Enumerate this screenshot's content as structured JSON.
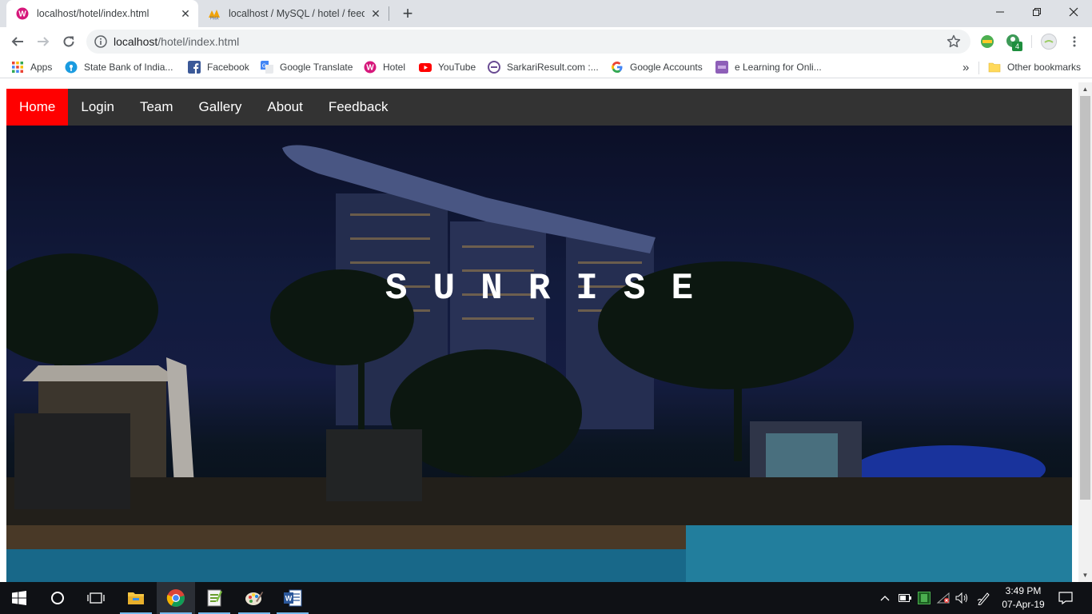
{
  "browser": {
    "tabs": [
      {
        "title": "localhost/hotel/index.html",
        "active": true,
        "favicon": "hotel-favicon-icon"
      },
      {
        "title": "localhost / MySQL / hotel / feedb",
        "active": false,
        "favicon": "phpmyadmin-icon"
      }
    ],
    "new_tab": "+",
    "url_host": "localhost",
    "url_path": "/hotel/index.html",
    "extension_badge": "4",
    "bookmarks": [
      {
        "label": "Apps",
        "icon": "apps-grid-icon"
      },
      {
        "label": "State Bank of India...",
        "icon": "sbi-icon"
      },
      {
        "label": "Facebook",
        "icon": "facebook-icon"
      },
      {
        "label": "Google Translate",
        "icon": "google-translate-icon"
      },
      {
        "label": "Hotel",
        "icon": "hotel-favicon-icon"
      },
      {
        "label": "YouTube",
        "icon": "youtube-icon"
      },
      {
        "label": "SarkariResult.com :...",
        "icon": "sarkariresult-icon"
      },
      {
        "label": "Google Accounts",
        "icon": "google-icon"
      },
      {
        "label": "e Learning for Onli...",
        "icon": "elearning-icon"
      }
    ],
    "bookmarks_overflow": "»",
    "other_bookmarks": "Other bookmarks"
  },
  "page": {
    "nav": [
      {
        "label": "Home",
        "active": true
      },
      {
        "label": "Login",
        "active": false
      },
      {
        "label": "Team",
        "active": false
      },
      {
        "label": "Gallery",
        "active": false
      },
      {
        "label": "About",
        "active": false
      },
      {
        "label": "Feedback",
        "active": false
      }
    ],
    "hero_title": "SUNRISE"
  },
  "taskbar": {
    "apps": [
      "start-icon",
      "search-cortana-icon",
      "task-view-icon",
      "file-explorer-icon",
      "chrome-icon",
      "notepad-plus-icon",
      "paint-icon",
      "word-icon"
    ],
    "time": "3:49 PM",
    "date": "07-Apr-19"
  },
  "colors": {
    "nav_bg": "#333333",
    "nav_active": "#ff0000",
    "tabstrip": "#dee1e6",
    "taskbar": "#0f1115"
  }
}
